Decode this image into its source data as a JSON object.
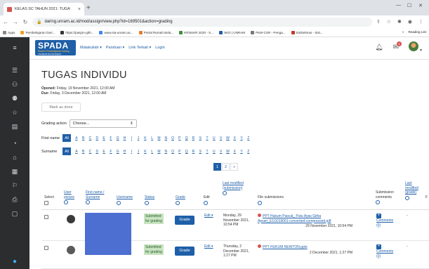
{
  "browser": {
    "tab_title": "KELAS SC TAHUN 2021: TUGA",
    "tab_close": "×",
    "new_tab": "+",
    "url": "daring.unram.ac.id/mod/assign/view.php?id=169501&action=grading",
    "bookmarks": [
      "Apps",
      "Pembelajaran Dari...",
      "https://pasjon-gith...",
      "www.sia-unram.ac...",
      "Portal Rumah Bela...",
      "KRNUKR 2020 - S...",
      "SKD | UNRAM",
      "PKM-CSR - Penga...",
      "Simbelmas - Sist..."
    ],
    "bookmarks_right": [
      "»",
      "Reading List"
    ]
  },
  "header": {
    "logo": "SPADA",
    "logo_subtitle": "Sistem Pembelajaran Daring",
    "logo_univ": "UNIVERSITAS MATARAM",
    "menu": [
      "Matakuliah ▾",
      "Panduan ▾",
      "Link Terkait ▾",
      "Login"
    ],
    "chat_badge": "1"
  },
  "page": {
    "title": "TUGAS INDIVIDU",
    "opened_label": "Opened:",
    "opened_value": "Friday, 19 November 2021, 12:00 AM",
    "due_label": "Due:",
    "due_value": "Friday, 3 December 2021, 12:00 AM",
    "mark_done": "Mark as done",
    "grading_action_label": "Grading action",
    "grading_action_value": "Choose...",
    "first_name_label": "First name",
    "surname_label": "Surname",
    "all_label": "All",
    "letters": [
      "A",
      "B",
      "C",
      "D",
      "E",
      "F",
      "G",
      "H",
      "I",
      "J",
      "K",
      "L",
      "M",
      "N",
      "O",
      "P",
      "Q",
      "R",
      "S",
      "T",
      "U",
      "V",
      "W",
      "X",
      "Y",
      "Z"
    ],
    "pages": [
      "1",
      "2",
      "»"
    ]
  },
  "table": {
    "headers": {
      "select": "Select",
      "user_picture": "User picture",
      "name": "First name / Surname",
      "username": "Username",
      "status": "Status",
      "grade": "Grade",
      "edit": "Edit",
      "last_modified_sub": "Last modified (submission)",
      "file_submissions": "File submissions",
      "submission_comments": "Submission comments",
      "last_modified_grade": "Last modified (grade)",
      "f": "F"
    },
    "rows": [
      {
        "status": "Submitted for grading",
        "grade_btn": "Grade",
        "edit": "Edit ▾",
        "modified": "Monday, 29 November 2021, 10:54 PM",
        "file": "PPT Hukum Pascal_ Putu Ayas Githa Apsari_E1G019061-converted-compressed.pdf",
        "file_date": "29 November 2021, 10:54 PM",
        "comments": "Comments (0)",
        "grade_modified": "-"
      },
      {
        "status": "Submitted for grading",
        "grade_btn": "Grade",
        "edit": "Edit ▾",
        "modified": "Thursday, 2 December 2021, 1:27 PM",
        "file": "PPT HUKUM NEWTON.pptx",
        "file_date": "2 December 2021, 1:27 PM",
        "comments": "Comments (0)",
        "grade_modified": "-"
      }
    ]
  },
  "colors": {
    "accent": "#1e5fa8",
    "sidebar": "#2b2d2f",
    "status_bg": "#c7e3c1",
    "redaction": "#4c6fd1"
  }
}
